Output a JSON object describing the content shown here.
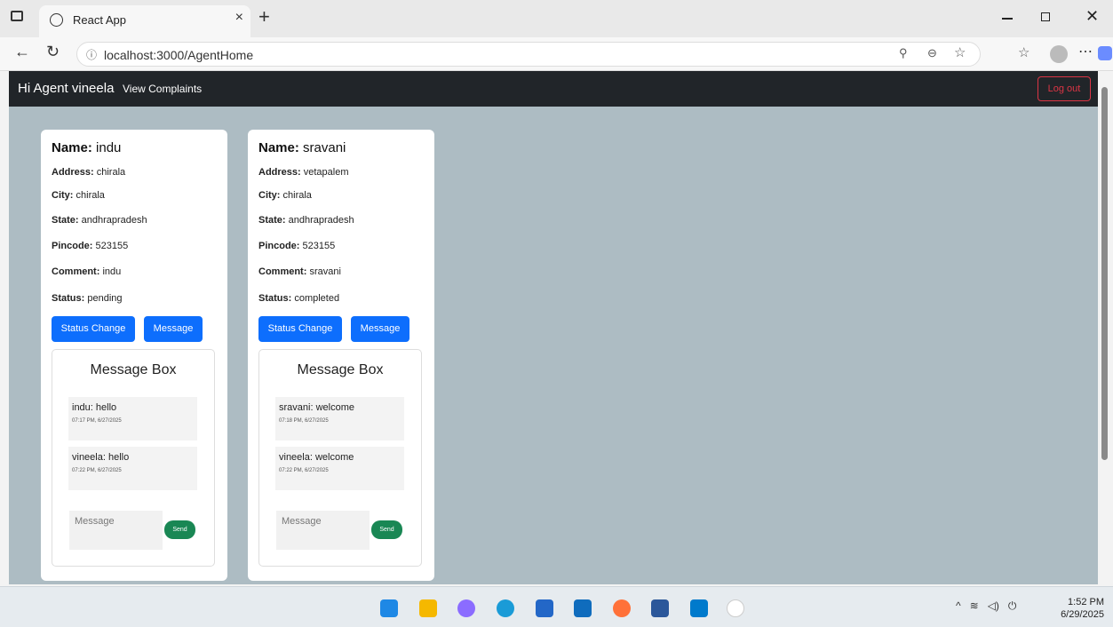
{
  "browser": {
    "tab_title": "React App",
    "tab_close": "×",
    "new_tab": "+",
    "url": "localhost:3000/AgentHome"
  },
  "navbar": {
    "brand": "Hi Agent vineela",
    "link": "View Complaints",
    "logout": "Log out"
  },
  "labels": {
    "name": "Name:",
    "address": "Address:",
    "city": "City:",
    "state": "State:",
    "pincode": "Pincode:",
    "comment": "Comment:",
    "status": "Status:",
    "status_change": "Status Change",
    "message": "Message",
    "message_box": "Message Box",
    "placeholder": "Message",
    "send": "Send"
  },
  "cards": [
    {
      "name": "indu",
      "address": "chirala",
      "city": "chirala",
      "state": "andhrapradesh",
      "pincode": "523155",
      "comment": "indu",
      "status": "pending",
      "messages": [
        {
          "text": "indu: hello",
          "time": "07:17 PM, 6/27/2025"
        },
        {
          "text": "vineela: hello",
          "time": "07:22 PM, 6/27/2025"
        }
      ]
    },
    {
      "name": "sravani",
      "address": "vetapalem",
      "city": "chirala",
      "state": "andhrapradesh",
      "pincode": "523155",
      "comment": "sravani",
      "status": "completed",
      "messages": [
        {
          "text": "sravani: welcome",
          "time": "07:18 PM, 6/27/2025"
        },
        {
          "text": "vineela: welcome",
          "time": "07:22 PM, 6/27/2025"
        }
      ]
    }
  ],
  "taskbar": {
    "time": "1:52 PM",
    "date": "6/29/2025"
  }
}
